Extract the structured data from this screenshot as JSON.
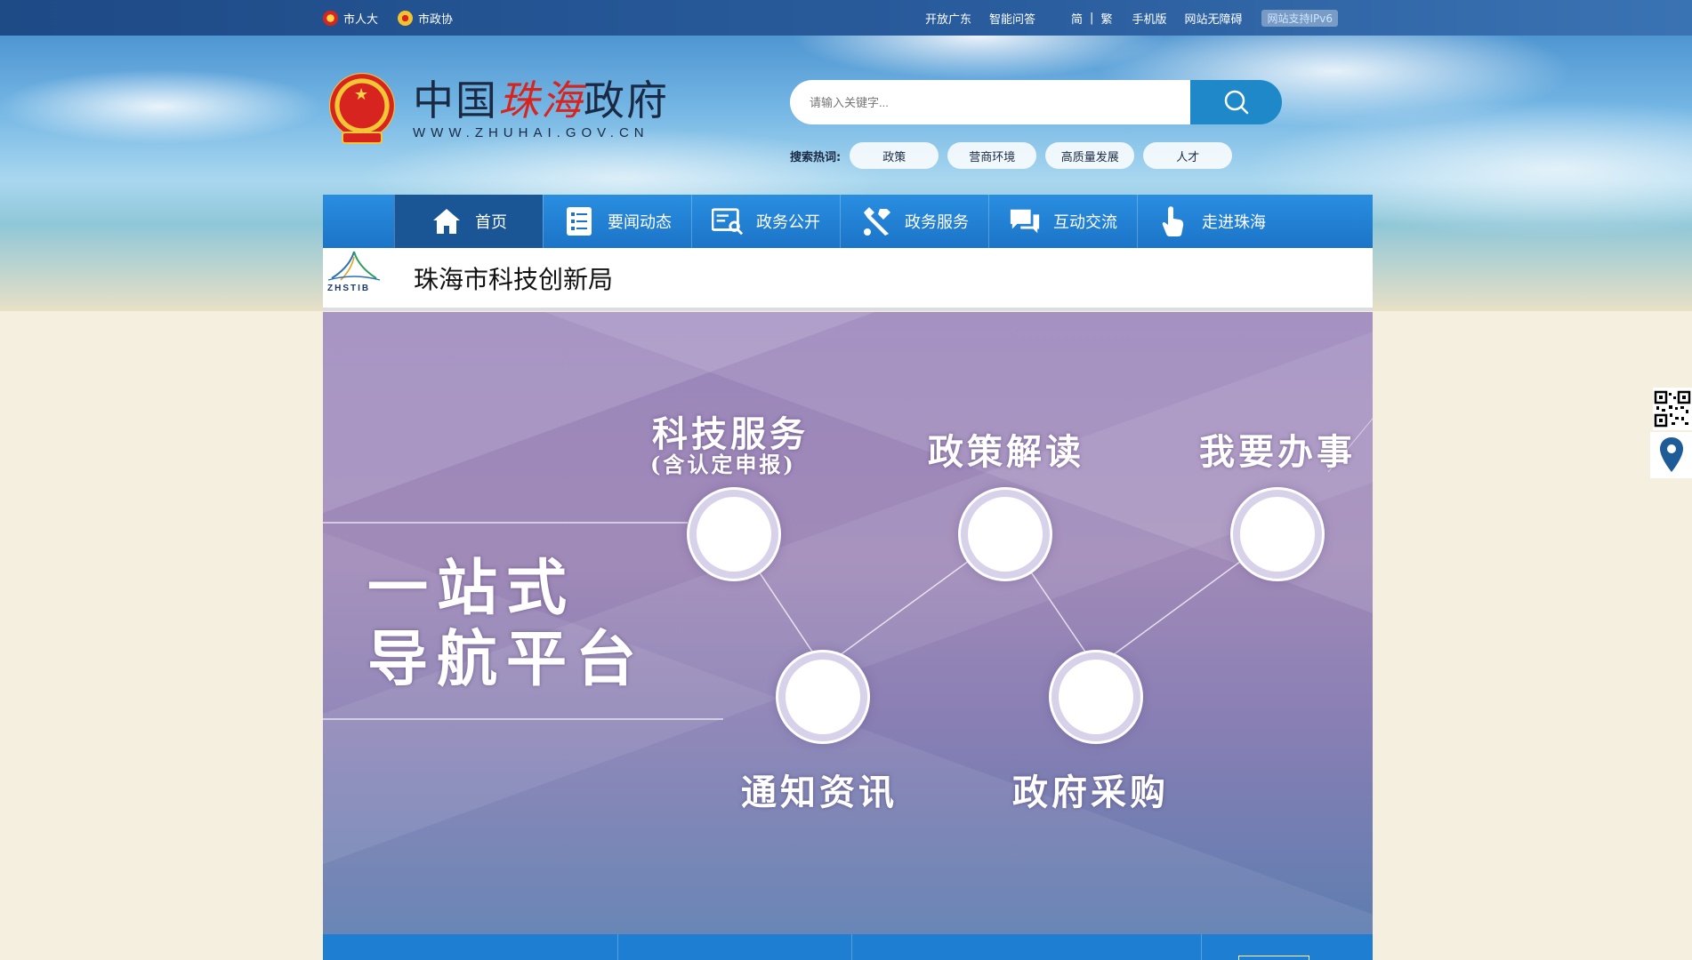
{
  "topbar": {
    "left_links": [
      "市人大",
      "市政协"
    ],
    "right_links": [
      "开放广东",
      "智能问答",
      "简",
      "|",
      "繁",
      "手机版",
      "网站无障碍"
    ],
    "ipv6_badge": "网站支持IPv6"
  },
  "logo": {
    "title_prefix": "中国",
    "title_brand": "珠海",
    "title_suffix": "政府",
    "url": "WWW.ZHUHAI.GOV.CN"
  },
  "search": {
    "placeholder": "请输入关键字...",
    "hot_label": "搜索热词:",
    "hot_tags": [
      "政策",
      "营商环境",
      "高质量发展",
      "人才"
    ]
  },
  "nav": {
    "items": [
      "首页",
      "要闻动态",
      "政务公开",
      "政务服务",
      "互动交流",
      "走进珠海"
    ],
    "active_index": 0
  },
  "department": {
    "logo_text": "ZHSTIB",
    "name": "珠海市科技创新局"
  },
  "banner": {
    "headline_line1": "一站式",
    "headline_line2": "导航平台",
    "nodes": [
      {
        "title": "科技服务",
        "subtitle": "(含认定申报)"
      },
      {
        "title": "政策解读"
      },
      {
        "title": "我要办事"
      },
      {
        "title": "通知资讯"
      },
      {
        "title": "政府采购"
      }
    ]
  },
  "colors": {
    "nav_blue": "#1b74c8",
    "nav_active": "#1a5596",
    "search_button": "#1e88c9",
    "brand_red": "#d8241f"
  }
}
